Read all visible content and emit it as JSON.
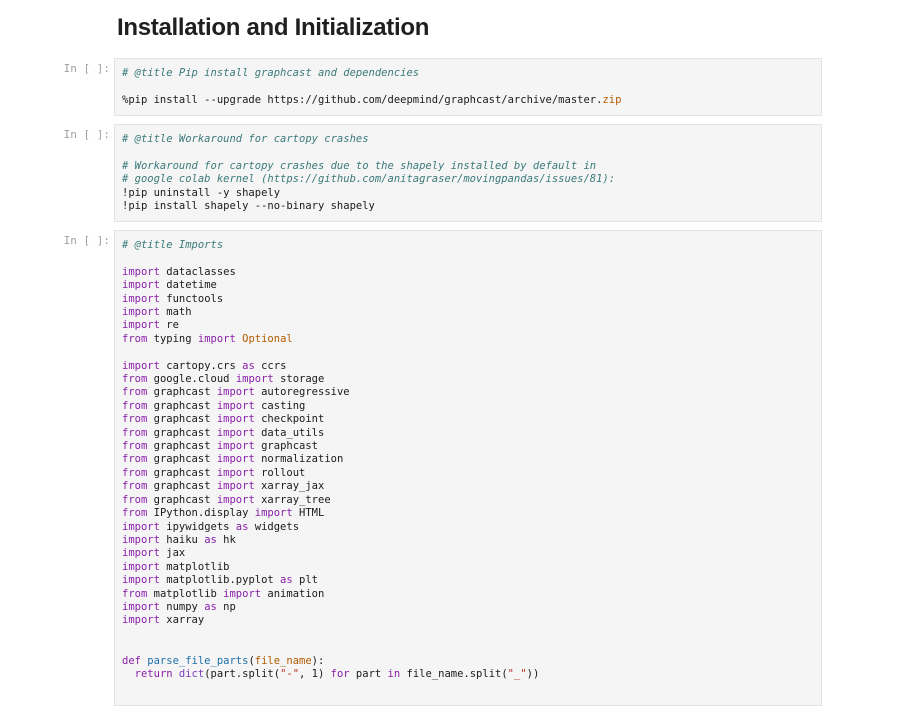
{
  "heading": "Installation and Initialization",
  "cells": [
    {
      "prompt": "In [ ]:",
      "lines": [
        [
          [
            "cm",
            "# @title Pip install graphcast and dependencies"
          ]
        ],
        [],
        [
          [
            "nm",
            "%pip install --upgrade https://github.com/deepmind/graphcast/archive/master."
          ],
          [
            "org",
            "zip"
          ]
        ]
      ]
    },
    {
      "prompt": "In [ ]:",
      "lines": [
        [
          [
            "cm",
            "# @title Workaround for cartopy crashes"
          ]
        ],
        [],
        [
          [
            "cm",
            "# Workaround for cartopy crashes due to the shapely installed by default in"
          ]
        ],
        [
          [
            "cm",
            "# google colab kernel (https://github.com/anitagraser/movingpandas/issues/81):"
          ]
        ],
        [
          [
            "nm",
            "!pip uninstall -y shapely"
          ]
        ],
        [
          [
            "nm",
            "!pip install shapely --no-binary shapely"
          ]
        ]
      ]
    },
    {
      "prompt": "In [ ]:",
      "lines": [
        [
          [
            "cm",
            "# @title Imports"
          ]
        ],
        [],
        [
          [
            "kw",
            "import"
          ],
          [
            "nm",
            " dataclasses"
          ]
        ],
        [
          [
            "kw",
            "import"
          ],
          [
            "nm",
            " datetime"
          ]
        ],
        [
          [
            "kw",
            "import"
          ],
          [
            "nm",
            " functools"
          ]
        ],
        [
          [
            "kw",
            "import"
          ],
          [
            "nm",
            " math"
          ]
        ],
        [
          [
            "kw",
            "import"
          ],
          [
            "nm",
            " re"
          ]
        ],
        [
          [
            "kw",
            "from"
          ],
          [
            "nm",
            " typing "
          ],
          [
            "kw",
            "import"
          ],
          [
            "org",
            " Optional"
          ]
        ],
        [],
        [
          [
            "kw",
            "import"
          ],
          [
            "nm",
            " cartopy.crs "
          ],
          [
            "kw",
            "as"
          ],
          [
            "nm",
            " ccrs"
          ]
        ],
        [
          [
            "kw",
            "from"
          ],
          [
            "nm",
            " google.cloud "
          ],
          [
            "kw",
            "import"
          ],
          [
            "nm",
            " storage"
          ]
        ],
        [
          [
            "kw",
            "from"
          ],
          [
            "nm",
            " graphcast "
          ],
          [
            "kw",
            "import"
          ],
          [
            "nm",
            " autoregressive"
          ]
        ],
        [
          [
            "kw",
            "from"
          ],
          [
            "nm",
            " graphcast "
          ],
          [
            "kw",
            "import"
          ],
          [
            "nm",
            " casting"
          ]
        ],
        [
          [
            "kw",
            "from"
          ],
          [
            "nm",
            " graphcast "
          ],
          [
            "kw",
            "import"
          ],
          [
            "nm",
            " checkpoint"
          ]
        ],
        [
          [
            "kw",
            "from"
          ],
          [
            "nm",
            " graphcast "
          ],
          [
            "kw",
            "import"
          ],
          [
            "nm",
            " data_utils"
          ]
        ],
        [
          [
            "kw",
            "from"
          ],
          [
            "nm",
            " graphcast "
          ],
          [
            "kw",
            "import"
          ],
          [
            "nm",
            " graphcast"
          ]
        ],
        [
          [
            "kw",
            "from"
          ],
          [
            "nm",
            " graphcast "
          ],
          [
            "kw",
            "import"
          ],
          [
            "nm",
            " normalization"
          ]
        ],
        [
          [
            "kw",
            "from"
          ],
          [
            "nm",
            " graphcast "
          ],
          [
            "kw",
            "import"
          ],
          [
            "nm",
            " rollout"
          ]
        ],
        [
          [
            "kw",
            "from"
          ],
          [
            "nm",
            " graphcast "
          ],
          [
            "kw",
            "import"
          ],
          [
            "nm",
            " xarray_jax"
          ]
        ],
        [
          [
            "kw",
            "from"
          ],
          [
            "nm",
            " graphcast "
          ],
          [
            "kw",
            "import"
          ],
          [
            "nm",
            " xarray_tree"
          ]
        ],
        [
          [
            "kw",
            "from"
          ],
          [
            "nm",
            " IPython.display "
          ],
          [
            "kw",
            "import"
          ],
          [
            "nm",
            " HTML"
          ]
        ],
        [
          [
            "kw",
            "import"
          ],
          [
            "nm",
            " ipywidgets "
          ],
          [
            "kw",
            "as"
          ],
          [
            "nm",
            " widgets"
          ]
        ],
        [
          [
            "kw",
            "import"
          ],
          [
            "nm",
            " haiku "
          ],
          [
            "kw",
            "as"
          ],
          [
            "nm",
            " hk"
          ]
        ],
        [
          [
            "kw",
            "import"
          ],
          [
            "nm",
            " jax"
          ]
        ],
        [
          [
            "kw",
            "import"
          ],
          [
            "nm",
            " matplotlib"
          ]
        ],
        [
          [
            "kw",
            "import"
          ],
          [
            "nm",
            " matplotlib.pyplot "
          ],
          [
            "kw",
            "as"
          ],
          [
            "nm",
            " plt"
          ]
        ],
        [
          [
            "kw",
            "from"
          ],
          [
            "nm",
            " matplotlib "
          ],
          [
            "kw",
            "import"
          ],
          [
            "nm",
            " animation"
          ]
        ],
        [
          [
            "kw",
            "import"
          ],
          [
            "nm",
            " numpy "
          ],
          [
            "kw",
            "as"
          ],
          [
            "nm",
            " np"
          ]
        ],
        [
          [
            "kw",
            "import"
          ],
          [
            "nm",
            " xarray"
          ]
        ],
        [],
        [],
        [
          [
            "kw",
            "def"
          ],
          [
            "fn",
            " parse_file_parts"
          ],
          [
            "nm",
            "("
          ],
          [
            "org",
            "file_name"
          ],
          [
            "nm",
            "):"
          ]
        ],
        [
          [
            "nm",
            "  "
          ],
          [
            "kw",
            "return"
          ],
          [
            "kw2",
            " dict"
          ],
          [
            "nm",
            "(part.split("
          ],
          [
            "str",
            "\"-\""
          ],
          [
            "nm",
            ", 1) "
          ],
          [
            "kw",
            "for"
          ],
          [
            "nm",
            " part "
          ],
          [
            "kw",
            "in"
          ],
          [
            "nm",
            " file_name.split("
          ],
          [
            "str",
            "\"_\""
          ],
          [
            "nm",
            "))"
          ]
        ]
      ]
    }
  ]
}
